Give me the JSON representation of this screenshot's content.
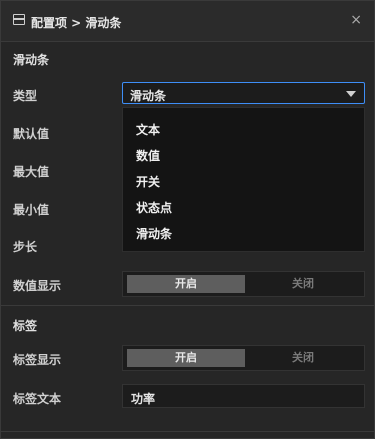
{
  "window": {
    "title": "配置项 > 滑动条",
    "icon": "panel-icon",
    "close_icon": "close-icon",
    "close_glyph": "×"
  },
  "section_slider": {
    "title": "滑动条",
    "type_label": "类型",
    "type_value": "滑动条",
    "dropdown_options": [
      "文本",
      "数值",
      "开关",
      "状态点",
      "滑动条"
    ],
    "default_label": "默认值",
    "max_label": "最大值",
    "min_label": "最小值",
    "step_label": "步长",
    "value_display_label": "数值显示",
    "value_display_on": "开启",
    "value_display_off": "关闭"
  },
  "section_label": {
    "title": "标签",
    "label_display_label": "标签显示",
    "label_display_on": "开启",
    "label_display_off": "关闭",
    "label_text_label": "标签文本",
    "label_text_value": "功率"
  },
  "colors": {
    "accent": "#3e8ef7",
    "background": "#262626",
    "active_segment": "#5e5e5e"
  }
}
